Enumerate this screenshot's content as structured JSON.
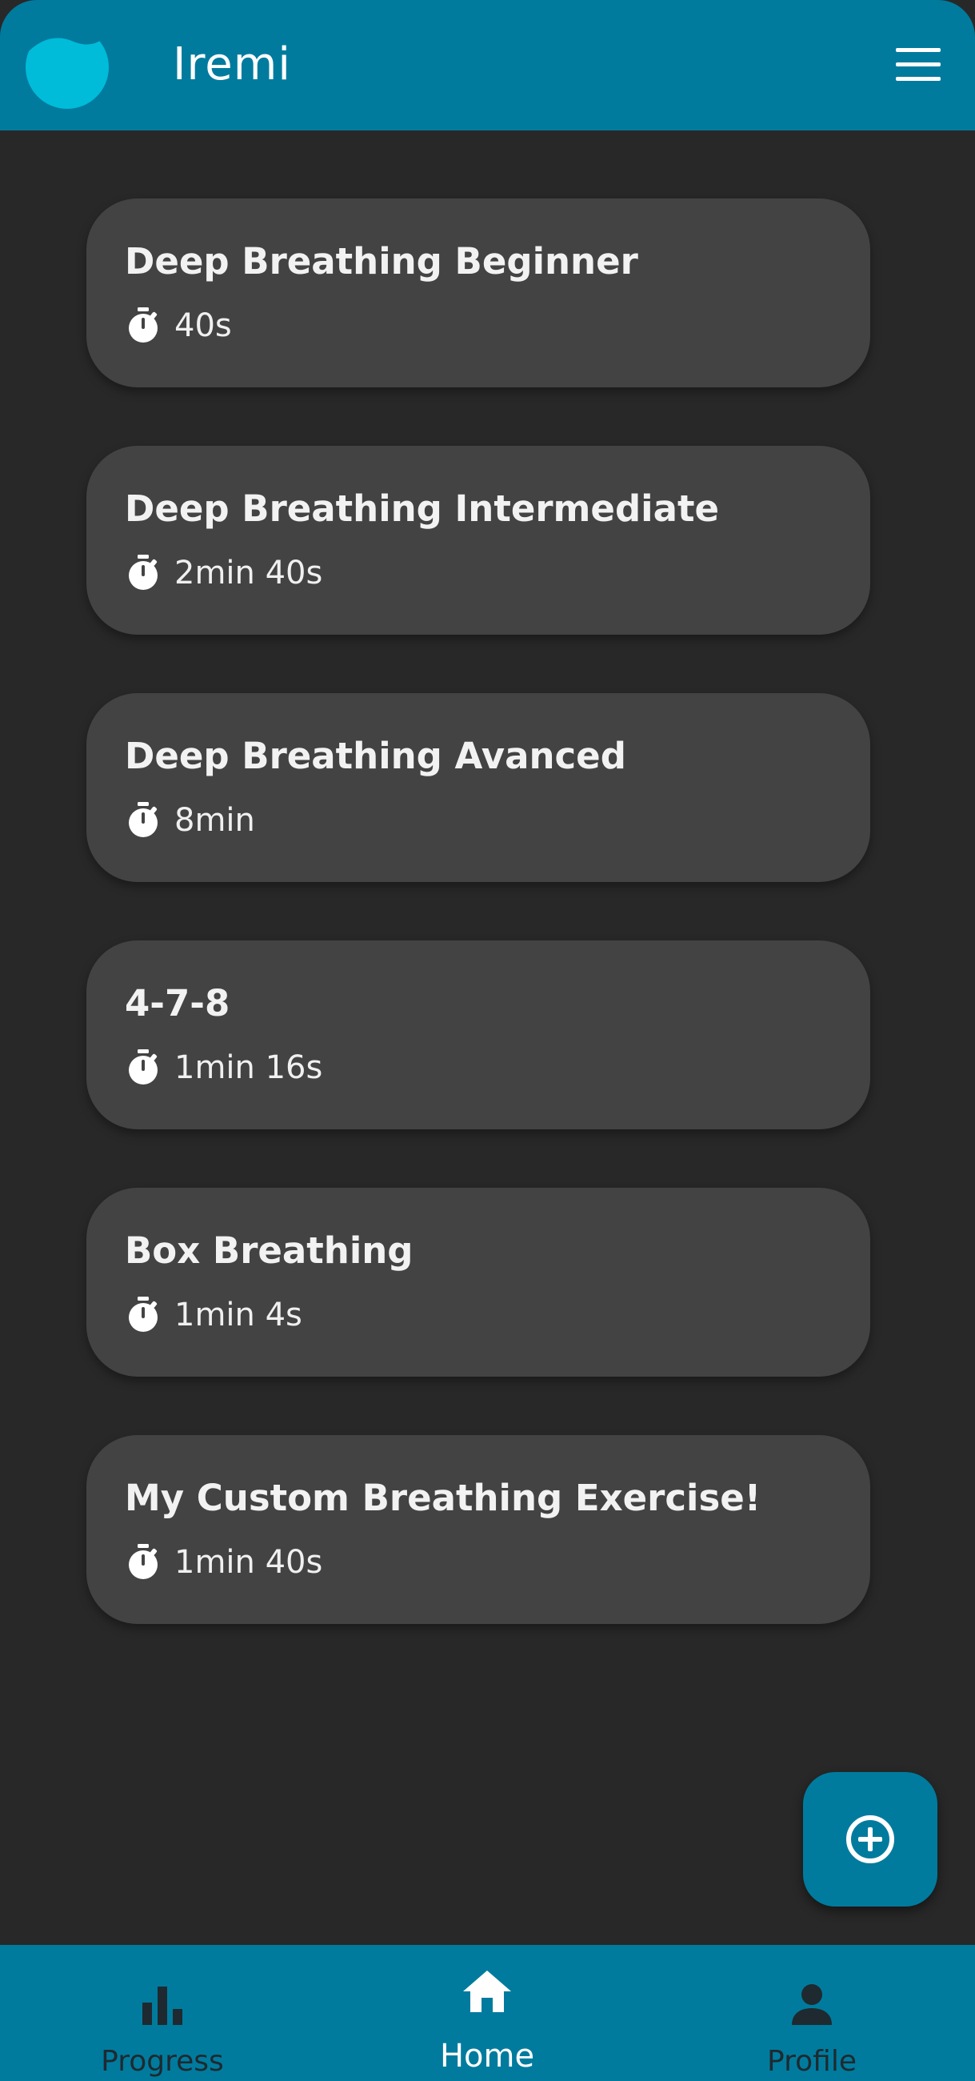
{
  "header": {
    "title": "Iremi",
    "logo_icon": "water-drop-logo-icon",
    "menu_icon": "hamburger-menu-icon"
  },
  "exercises": [
    {
      "title": "Deep Breathing Beginner",
      "duration": "40s"
    },
    {
      "title": "Deep Breathing Intermediate",
      "duration": "2min 40s"
    },
    {
      "title": "Deep Breathing Avanced",
      "duration": "8min"
    },
    {
      "title": "4-7-8",
      "duration": "1min 16s"
    },
    {
      "title": "Box Breathing",
      "duration": "1min 4s"
    },
    {
      "title": "My Custom Breathing Exercise!",
      "duration": "1min 40s"
    }
  ],
  "fab": {
    "icon": "add-circle-icon"
  },
  "bottom_nav": {
    "items": [
      {
        "label": "Progress",
        "icon": "bar-chart-icon",
        "active": false
      },
      {
        "label": "Home",
        "icon": "home-icon",
        "active": true
      },
      {
        "label": "Profile",
        "icon": "person-icon",
        "active": false
      }
    ]
  },
  "colors": {
    "primary": "#007b9e",
    "background": "#282828",
    "card": "#434343",
    "logo": "#00bcd9",
    "nav_inactive": "#1e2a30",
    "nav_active": "#ffffff"
  }
}
